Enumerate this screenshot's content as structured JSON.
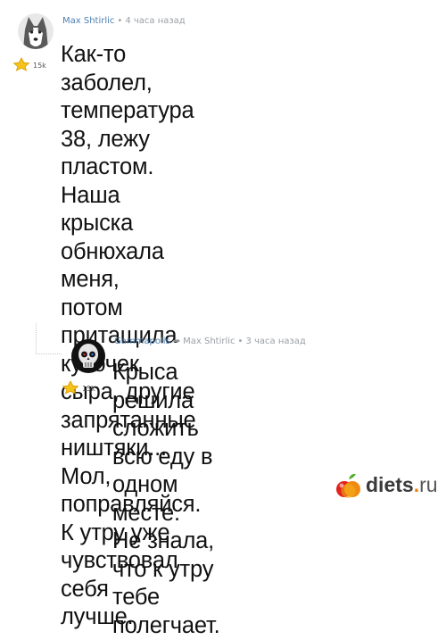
{
  "comments": [
    {
      "author": "Max Shtirlic",
      "time": "4 часа назад",
      "reputation": "15k",
      "text_lines": [
        "Как-то заболел, температура",
        "38, лежу пластом. Наша",
        "крыска обнюхала меня,",
        "потом притащила кусочек",
        "сыра, другие запрятанные",
        "ништяки... Мол, поправляйся.",
        "К утру уже чувствовал себя",
        "лучше."
      ]
    },
    {
      "author": "Gammapolis",
      "reply_to": "Max Shtirlic",
      "time": "3 часа назад",
      "reputation": "15k",
      "text_lines": [
        "Крыса решила сложить",
        "всю еду в одном месте.",
        "Не знала, что к утру тебе",
        "полегчает."
      ]
    }
  ],
  "watermark": {
    "name": "diets",
    "tld": "ru"
  }
}
